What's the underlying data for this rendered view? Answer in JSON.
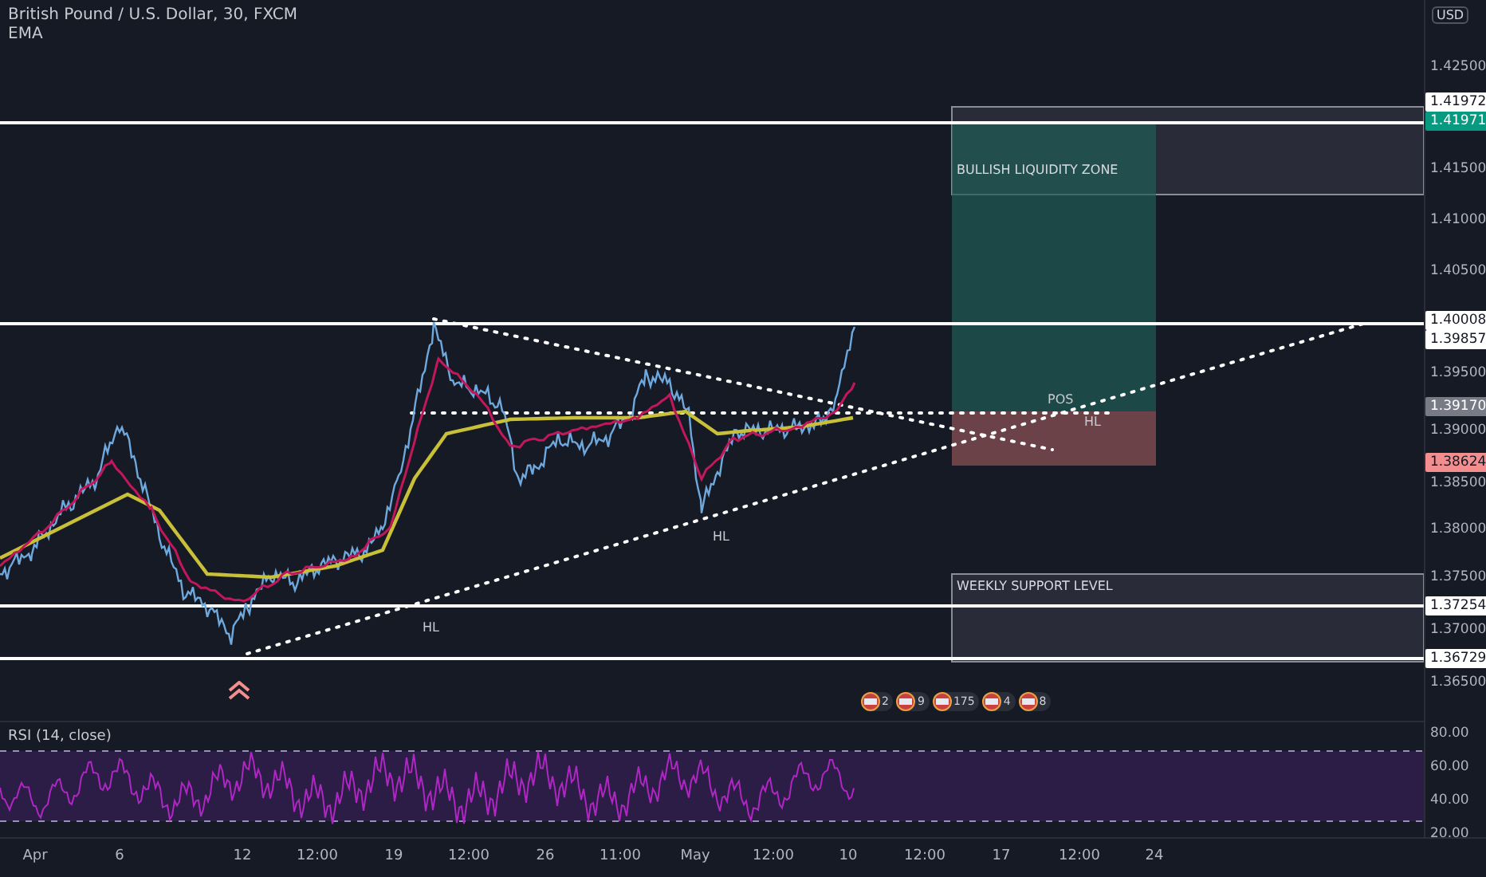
{
  "legend": {
    "symbol": "British Pound / U.S. Dollar, 30, FXCM",
    "indicator": "EMA"
  },
  "currency": "USD",
  "price_ticks": [
    "1.42500",
    "1.41500",
    "1.41000",
    "1.40500",
    "1.39500",
    "1.39000",
    "1.38500",
    "1.38000",
    "1.37500",
    "1.37000",
    "1.36500"
  ],
  "price_tags": [
    {
      "value": "1.41972",
      "color": "#ffffff"
    },
    {
      "value": "1.41971",
      "color": "#089981"
    },
    {
      "value": "1.40008",
      "color": "#ffffff"
    },
    {
      "value": "1.39857",
      "color": "#ffffff"
    },
    {
      "value": "1.39170",
      "color": "#787b86"
    },
    {
      "value": "1.38624",
      "color": "#f28e8e"
    },
    {
      "value": "1.37254",
      "color": "#ffffff"
    },
    {
      "value": "1.36729",
      "color": "#ffffff"
    }
  ],
  "zones": [
    {
      "label": "BULLISH LIQUIDITY ZONE"
    },
    {
      "label": "WEEKLY SUPPORT LEVEL"
    }
  ],
  "chart_labels": [
    "HL",
    "HL",
    "POS",
    "HL"
  ],
  "event_markers": [
    {
      "count": "2"
    },
    {
      "count": "9"
    },
    {
      "count": "175"
    },
    {
      "count": "4"
    },
    {
      "count": "8"
    }
  ],
  "rsi": {
    "label": "RSI (14, close)",
    "ticks": [
      "80.00",
      "60.00",
      "40.00",
      "20.00"
    ]
  },
  "time_ticks": [
    "Apr",
    "6",
    "12",
    "12:00",
    "19",
    "12:00",
    "26",
    "11:00",
    "May",
    "12:00",
    "10",
    "12:00",
    "17",
    "12:00",
    "24"
  ]
}
